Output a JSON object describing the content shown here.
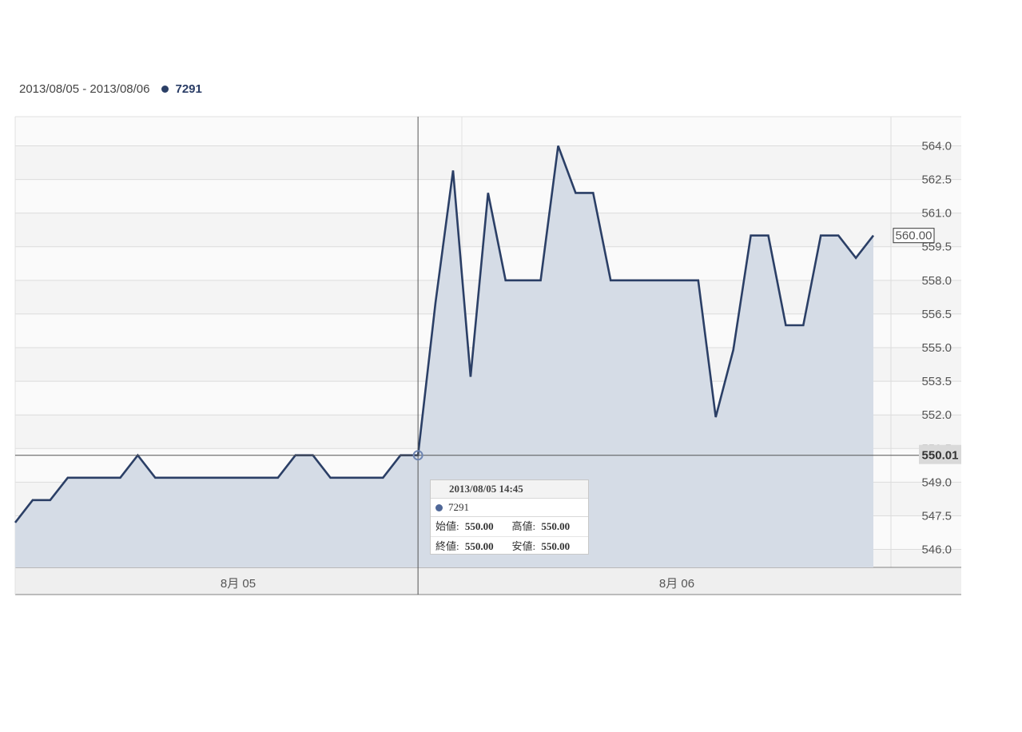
{
  "legend": {
    "date_range": "2013/08/05 - 2013/08/06",
    "series_name": "7291",
    "series_color": "#2b3f66"
  },
  "chart_data": {
    "type": "area",
    "title": "",
    "xlabel": "",
    "ylabel": "",
    "x_categories": [
      "8月 05",
      "8月 06"
    ],
    "ylim": [
      545.2,
      565.3
    ],
    "y_ticks": [
      "564.0",
      "562.5",
      "561.0",
      "559.5",
      "558.0",
      "556.5",
      "555.0",
      "553.5",
      "552.0",
      "550.5",
      "549.0",
      "547.5",
      "546.0"
    ],
    "grid": true,
    "legend_position": "top-left",
    "series": [
      {
        "name": "7291",
        "color": "#2b3f66",
        "fill": "#d5dce6",
        "values": [
          547.2,
          548.2,
          548.2,
          549.2,
          549.2,
          549.2,
          549.2,
          550.2,
          549.2,
          549.2,
          549.2,
          549.2,
          549.2,
          549.2,
          549.2,
          549.2,
          550.2,
          550.2,
          549.2,
          549.2,
          549.2,
          549.2,
          550.2,
          550.2,
          557.0,
          562.9,
          553.7,
          561.9,
          558.0,
          558.0,
          558.0,
          564.0,
          561.9,
          561.9,
          558.0,
          558.0,
          558.0,
          558.0,
          558.0,
          558.0,
          551.9,
          554.9,
          560.0,
          560.0,
          556.0,
          556.0,
          560.0,
          560.0,
          559.0,
          560.0
        ]
      }
    ],
    "current_value_label": "560.00",
    "crosshair_value_label": "550.01",
    "tooltip": {
      "timestamp": "2013/08/05 14:45",
      "series": "7291",
      "open_label": "始値",
      "open_value": "550.00",
      "high_label": "高値",
      "high_value": "550.00",
      "close_label": "終値",
      "close_value": "550.00",
      "low_label": "安値",
      "low_value": "550.00"
    }
  }
}
